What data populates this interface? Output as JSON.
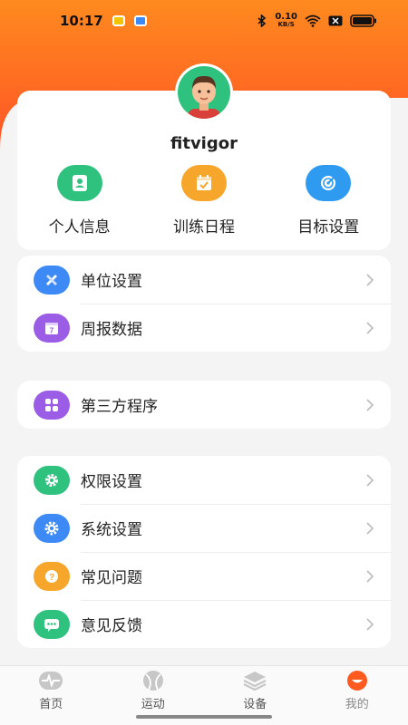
{
  "status_bar": {
    "time": "10:17",
    "net_speed": "0.10",
    "net_unit": "KB/S"
  },
  "profile": {
    "username": "fitvigor",
    "quick_actions": [
      {
        "label": "个人信息",
        "icon": "id-card-icon",
        "color": "#2ec27e"
      },
      {
        "label": "训练日程",
        "icon": "calendar-check-icon",
        "color": "#f7a62c"
      },
      {
        "label": "目标设置",
        "icon": "target-icon",
        "color": "#2f9bf0"
      }
    ]
  },
  "group1": [
    {
      "label": "单位设置",
      "icon": "ruler-pencil-icon",
      "color": "#3d8af7"
    },
    {
      "label": "周报数据",
      "icon": "calendar-7-icon",
      "color": "#9b5de5"
    }
  ],
  "group2": [
    {
      "label": "第三方程序",
      "icon": "apps-grid-icon",
      "color": "#9b5de5"
    }
  ],
  "group3": [
    {
      "label": "权限设置",
      "icon": "gear-icon",
      "color": "#2ec27e"
    },
    {
      "label": "系统设置",
      "icon": "settings-icon",
      "color": "#3d8af7"
    },
    {
      "label": "常见问题",
      "icon": "question-icon",
      "color": "#f7a62c"
    },
    {
      "label": "意见反馈",
      "icon": "chat-icon",
      "color": "#2ec27e"
    }
  ],
  "tabs": [
    {
      "label": "首页",
      "icon": "heartbeat-icon"
    },
    {
      "label": "运动",
      "icon": "ball-icon"
    },
    {
      "label": "设备",
      "icon": "layers-icon"
    },
    {
      "label": "我的",
      "icon": "profile-icon",
      "active": true
    }
  ],
  "colors": {
    "accent": "#ff6a22"
  }
}
